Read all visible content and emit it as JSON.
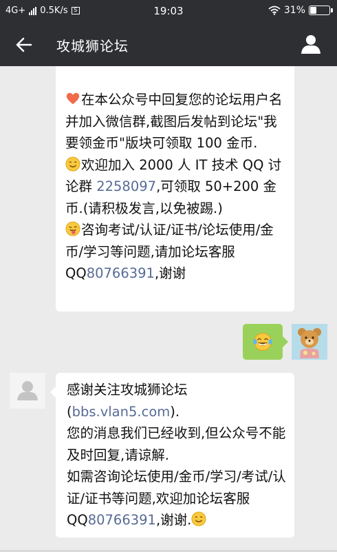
{
  "status_bar": {
    "network": "4G+",
    "speed": "0.5K/s",
    "notification_icon": "S",
    "time": "19:03",
    "battery_pct": "31%",
    "battery_level": 0.31
  },
  "header": {
    "title": "攻城狮论坛",
    "back_icon": "arrow-left-icon",
    "profile_icon": "person-icon"
  },
  "messages": {
    "top": {
      "p1": "在本公众号中回复您的论坛用户名并加入微信群,截图后发帖到论坛\"我要领金币\"版块可领取 100 金币.",
      "p2a": "欢迎加入 2000 人 IT 技术 QQ 讨论群 ",
      "p2_link": "2258097",
      "p2b": ",可领取 50+200 金币.(请积极发言,以免被踢.)",
      "p3a": "咨询考试/认证/证书/论坛使用/金币/学习等问题,请加论坛客服 QQ",
      "p3_link": "80766391",
      "p3b": ",谢谢"
    },
    "sent": {
      "emoji": "tears-of-joy-emoji"
    },
    "bottom": {
      "l1a": "感谢关注攻城狮论坛(",
      "l1_link": "bbs.vlan5.com",
      "l1b": ").",
      "l2": "您的消息我们已经收到,但公众号不能及时回复,请谅解.",
      "l3a": "如需咨询论坛使用/金币/学习/考试/认证/证书等问题,欢迎加论坛客服 QQ",
      "l3_link": "80766391",
      "l3b": ",谢谢."
    }
  },
  "colors": {
    "header_bg": "#2e2f33",
    "chat_bg": "#ebebeb",
    "link": "#576b95",
    "sent_bubble": "#9ad15b"
  }
}
